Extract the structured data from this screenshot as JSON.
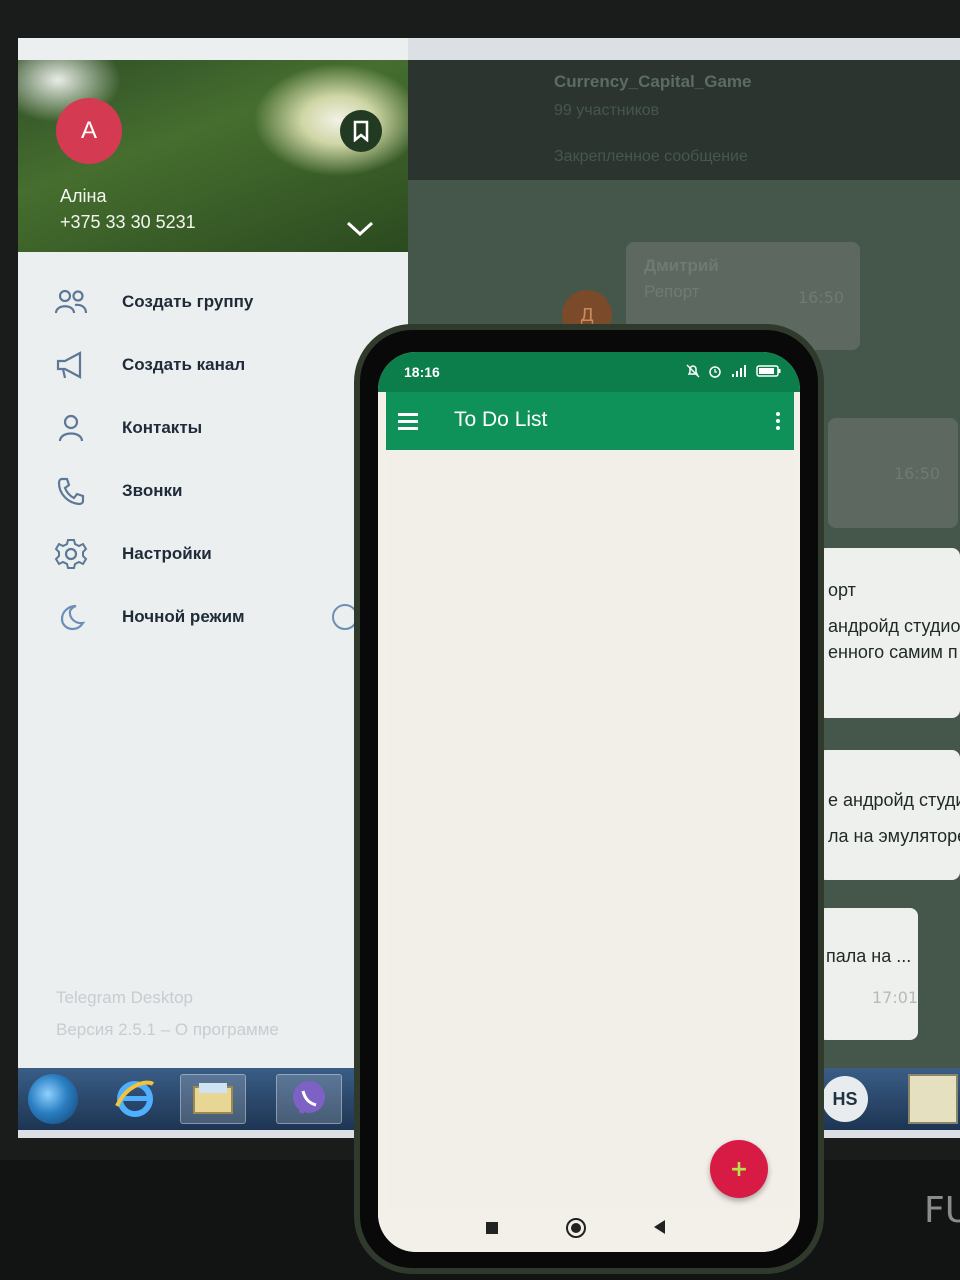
{
  "telegram": {
    "avatar_letter": "A",
    "user_name": "Аліна",
    "user_phone": "+375 33 30  5231",
    "menu": [
      {
        "label": "Создать группу",
        "icon": "group-icon"
      },
      {
        "label": "Создать канал",
        "icon": "megaphone-icon"
      },
      {
        "label": "Контакты",
        "icon": "contact-icon"
      },
      {
        "label": "Звонки",
        "icon": "phone-icon"
      },
      {
        "label": "Настройки",
        "icon": "gear-icon"
      },
      {
        "label": "Ночной режим",
        "icon": "moon-icon"
      }
    ],
    "footer_app": "Telegram Desktop",
    "footer_version": "Версия 2.5.1 – О программе",
    "chat": {
      "title": "Currency_Capital_Game",
      "members": "99 участников",
      "pinned": "Закрепленное сообщение",
      "avatar_letter": "Д",
      "sender": "Дмитрий",
      "reply": "Репорт",
      "time_1": "16:50",
      "time_2": "16:50",
      "snippets": [
        "орт",
        "андройд студио",
        "енного самим п",
        "е андройд студи",
        "ла на эмуляторе",
        "пала на ..."
      ],
      "time_3": "17:01"
    },
    "taskbar": {
      "hs_label": "HS"
    }
  },
  "monitor": {
    "brand": "FU"
  },
  "phone": {
    "status_time": "18:16",
    "battery": "83",
    "app_title": "To Do List",
    "fab_label": "+"
  },
  "colors": {
    "status_bar": "#0b7e4c",
    "app_bar": "#0f9259",
    "fab": "#d81b45",
    "avatar": "#d43a52"
  }
}
